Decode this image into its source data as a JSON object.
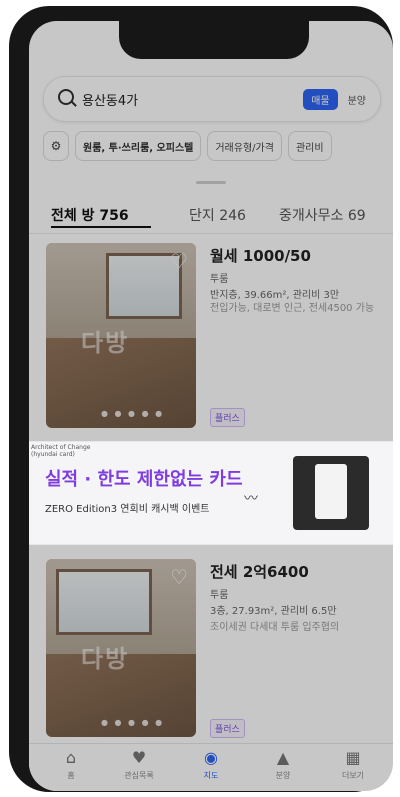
{
  "search": {
    "query": "용산동4가",
    "toggle_on": "매물",
    "toggle_off": "분양"
  },
  "filters": [
    "원룸, 투·쓰리룸, 오피스텔",
    "거래유형/가격",
    "관리비"
  ],
  "tabs": [
    {
      "label": "전체 방 756",
      "active": true
    },
    {
      "label": "단지 246",
      "active": false
    },
    {
      "label": "중개사무소 69",
      "active": false
    }
  ],
  "listings": [
    {
      "price": "월세 1000/50",
      "type": "투룸",
      "details": "반지층, 39.66m², 관리비 3만",
      "desc": "전입가능, 대로변 인근, 전세4500 가능",
      "badge": "플러스",
      "watermark": "다방"
    },
    {
      "price": "전세 2억6400",
      "type": "투룸",
      "details": "3층, 27.93m², 관리비 6.5만",
      "desc": "조이세권 다세대 투룸 입주협의",
      "badge": "플러스",
      "watermark": "다방"
    }
  ],
  "ad": {
    "brand": "Architect of Change (hyundai card)",
    "headline": "실적 · 한도 제한없는 카드",
    "sub": "ZERO Edition3 연회비 캐시백 이벤트"
  },
  "tabbar": [
    {
      "label": "홈",
      "icon": "home-icon",
      "active": false
    },
    {
      "label": "관심목록",
      "icon": "heart-icon",
      "active": false
    },
    {
      "label": "지도",
      "icon": "map-pin-icon",
      "active": true
    },
    {
      "label": "분양",
      "icon": "building-icon",
      "active": false
    },
    {
      "label": "더보기",
      "icon": "grid-icon",
      "active": false
    }
  ],
  "colors": {
    "accent": "#2c64f6",
    "ad_purple": "#7f3de0",
    "badge_purple": "#7a55d6"
  }
}
